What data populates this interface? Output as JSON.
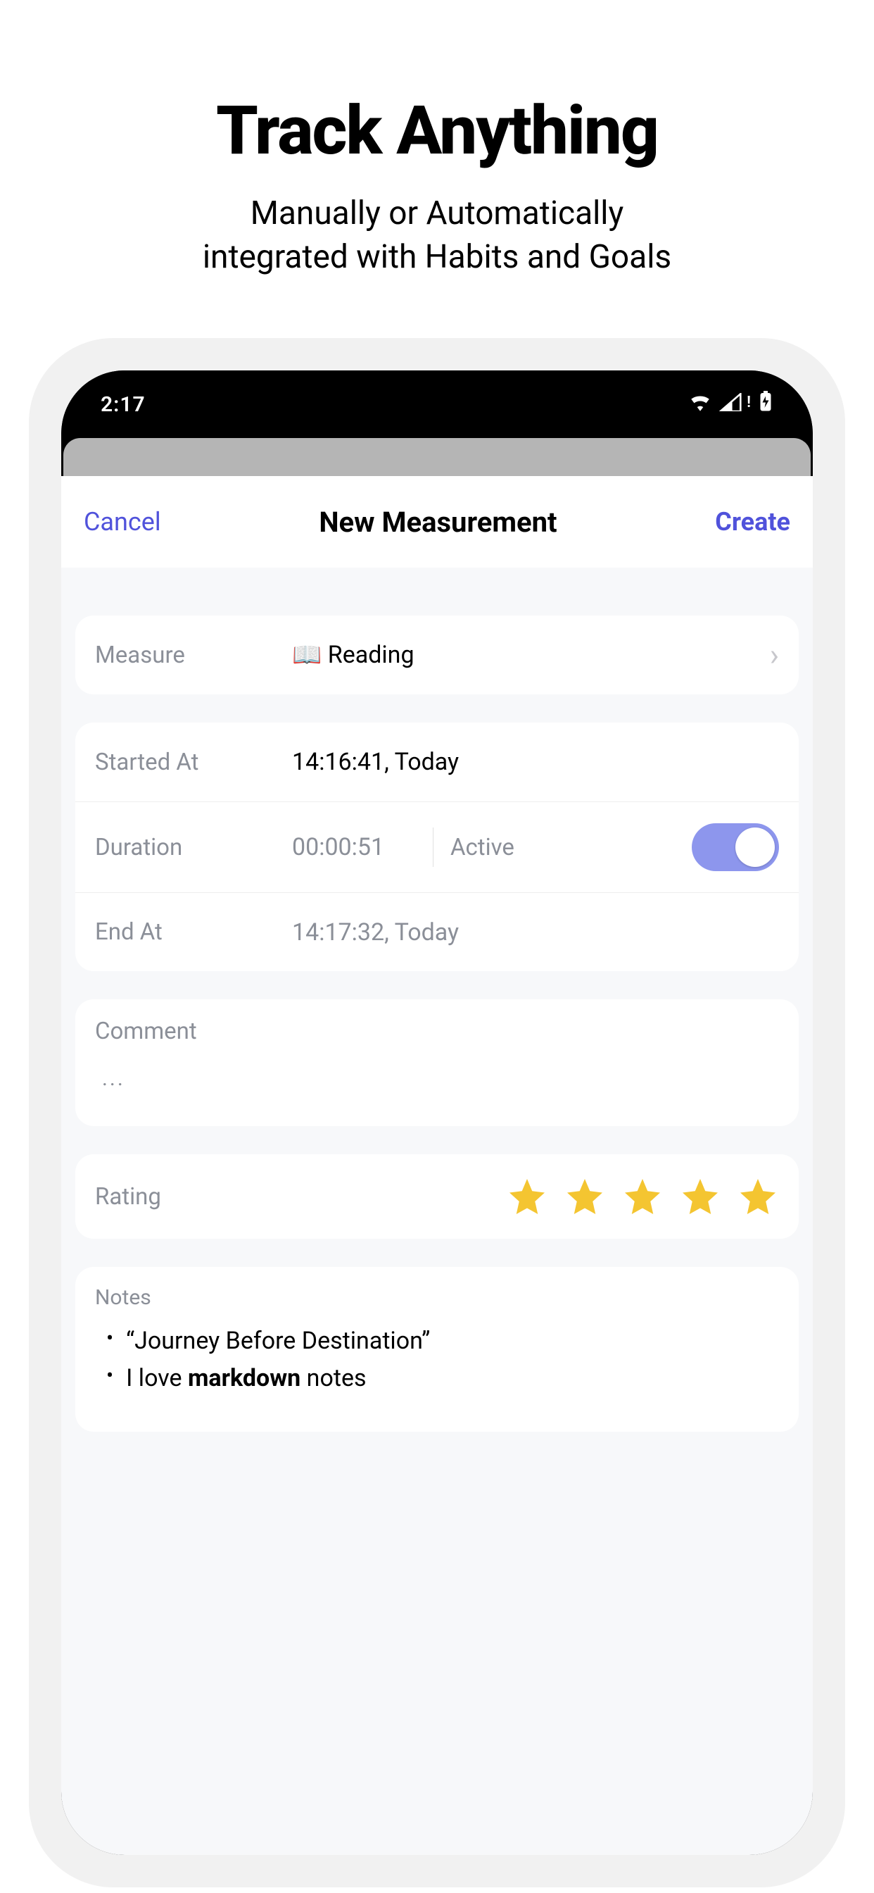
{
  "marketing": {
    "title": "Track Anything",
    "subtitle_l1": "Manually or Automatically",
    "subtitle_l2": "integrated with Habits and Goals"
  },
  "status": {
    "time": "2:17"
  },
  "modal": {
    "cancel": "Cancel",
    "title": "New Measurement",
    "create": "Create"
  },
  "measure": {
    "label": "Measure",
    "value": "📖 Reading"
  },
  "started": {
    "label": "Started At",
    "value": "14:16:41, Today"
  },
  "duration": {
    "label": "Duration",
    "value": "00:00:51",
    "active_label": "Active",
    "active": true
  },
  "end": {
    "label": "End At",
    "value": "14:17:32, Today"
  },
  "comment": {
    "label": "Comment",
    "placeholder": "..."
  },
  "rating": {
    "label": "Rating",
    "value": 5
  },
  "notes": {
    "label": "Notes",
    "item1_text": "“Journey Before Destination”",
    "item2_prefix": "I love ",
    "item2_bold": "markdown",
    "item2_suffix": " notes"
  }
}
